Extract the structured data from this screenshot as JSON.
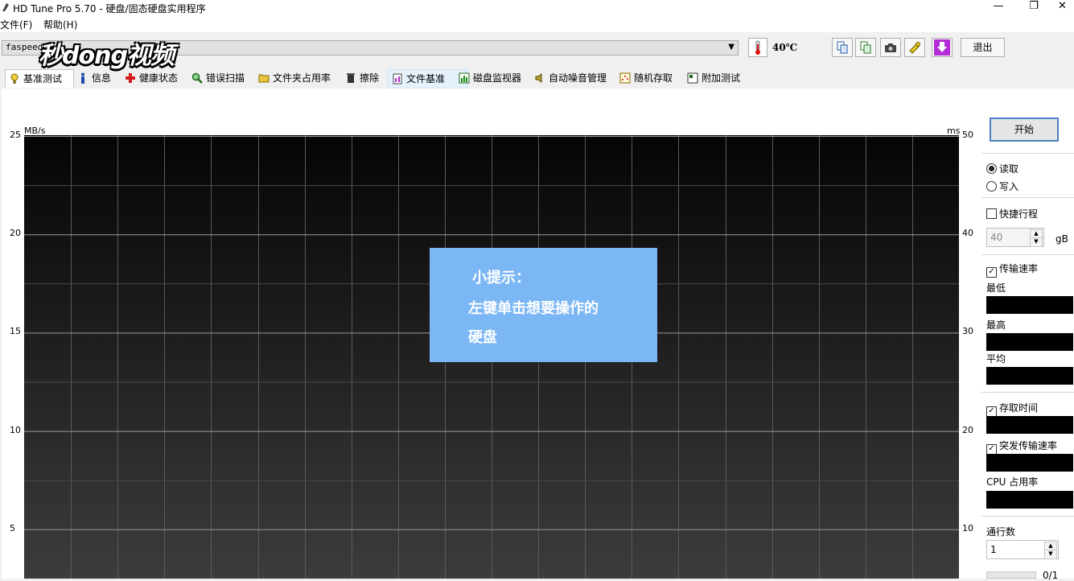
{
  "window": {
    "title": "HD Tune Pro 5.70 - 硬盘/固态硬盘实用程序",
    "minimize_glyph": "—",
    "maximize_glyph": "❐",
    "close_glyph": "✕"
  },
  "menu": [
    "文件(F)",
    "帮助(H)"
  ],
  "toolbar": {
    "drive": "faspeed",
    "temperature": "40℃",
    "exit_label": "退出",
    "icons": [
      "copy-info-icon",
      "copy-all-icon",
      "screenshot-icon",
      "options-icon",
      "download-icon"
    ]
  },
  "watermark": "秒dong视频",
  "tabs": [
    {
      "label": "基准测试",
      "icon": "benchmark-icon",
      "active": true
    },
    {
      "label": "信息",
      "icon": "info-icon"
    },
    {
      "label": "健康状态",
      "icon": "health-icon"
    },
    {
      "label": "错误扫描",
      "icon": "error-scan-icon"
    },
    {
      "label": "文件夹占用率",
      "icon": "folder-usage-icon"
    },
    {
      "label": "擦除",
      "icon": "erase-icon"
    },
    {
      "label": "文件基准",
      "icon": "file-benchmark-icon",
      "hover": true
    },
    {
      "label": "磁盘监视器",
      "icon": "disk-monitor-icon"
    },
    {
      "label": "自动噪音管理",
      "icon": "noise-icon"
    },
    {
      "label": "随机存取",
      "icon": "random-access-icon"
    },
    {
      "label": "附加测试",
      "icon": "extra-tests-icon"
    }
  ],
  "chart_data": {
    "type": "line",
    "ylabel_left": "MB/s",
    "ylabel_right": "ms",
    "y_left_ticks": [
      "25",
      "20",
      "15",
      "10",
      "5"
    ],
    "y_right_ticks": [
      "50",
      "40",
      "30",
      "20",
      "10"
    ],
    "ylim_left": [
      0,
      25
    ],
    "ylim_right": [
      0,
      50
    ],
    "grid": true,
    "series": []
  },
  "tip": {
    "line1": "小提示：",
    "line2": "左键单击想要操作的",
    "line3": "硬盘"
  },
  "side": {
    "start_label": "开始",
    "read_label": "读取",
    "write_label": "写入",
    "read_selected": true,
    "short_stroke_label": "快捷行程",
    "short_stroke_value": "40",
    "short_stroke_unit": "gB",
    "transfer_rate_label": "传输速率",
    "min_label": "最低",
    "max_label": "最高",
    "avg_label": "平均",
    "access_time_label": "存取时间",
    "burst_rate_label": "突发传输速率",
    "cpu_label": "CPU 占用率",
    "passes_label": "通行数",
    "passes_value": "1",
    "progress_text": "0/1"
  }
}
